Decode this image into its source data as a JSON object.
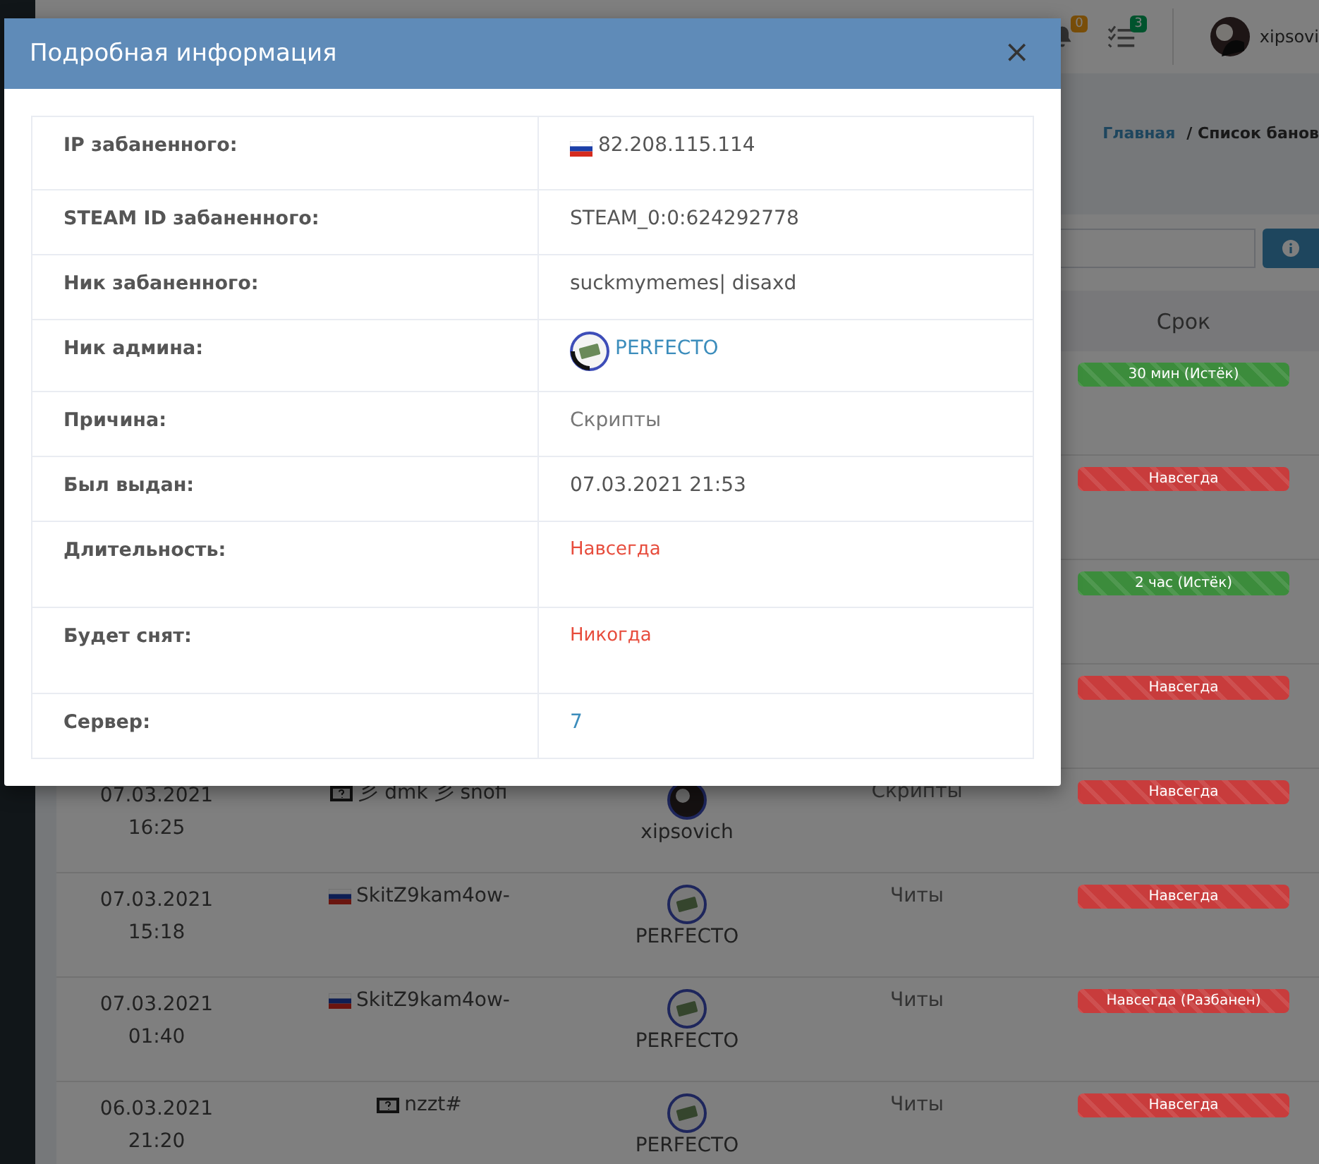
{
  "header": {
    "notifications_badge": "0",
    "tasks_badge": "3",
    "user_name": "xipsovi"
  },
  "breadcrumb": [
    {
      "label": "Главная",
      "kind": "link"
    },
    {
      "label": "/ Список банов",
      "kind": "current"
    }
  ],
  "table": {
    "term_header": "Срок",
    "rows": [
      {
        "term": {
          "text": "30 мин (Истёк)",
          "color": "#3c8c3c"
        }
      },
      {
        "term": {
          "text": "Навсегда",
          "color": "#c83c3c"
        }
      },
      {
        "term": {
          "text": "2 час (Истёк)",
          "color": "#3c8c3c"
        }
      },
      {
        "term": {
          "text": "Навсегда",
          "color": "#c83c3c"
        }
      },
      {
        "date": "07.03.2021",
        "time": "16:25",
        "player": {
          "kind": "unknown",
          "name": "彡 dmk 彡 snofi"
        },
        "admin": {
          "name": "xipsovich",
          "kind": "dark"
        },
        "reason": "Скрипты",
        "term": {
          "text": "Навсегда",
          "color": "#c83c3c"
        }
      },
      {
        "date": "07.03.2021",
        "time": "15:18",
        "player": {
          "kind": "ru",
          "name": "SkitZ9kam4ow-"
        },
        "admin": {
          "name": "PERFECTO",
          "kind": "money"
        },
        "reason": "Читы",
        "term": {
          "text": "Навсегда",
          "color": "#c83c3c"
        }
      },
      {
        "date": "07.03.2021",
        "time": "01:40",
        "player": {
          "kind": "ru",
          "name": "SkitZ9kam4ow-"
        },
        "admin": {
          "name": "PERFECTO",
          "kind": "money"
        },
        "reason": "Читы",
        "term": {
          "text": "Навсегда (Разбанен)",
          "color": "#c83c3c"
        }
      },
      {
        "date": "06.03.2021",
        "time": "21:20",
        "player": {
          "kind": "unknown",
          "name": "nzzt#"
        },
        "admin": {
          "name": "PERFECTO",
          "kind": "money"
        },
        "reason": "Читы",
        "term": {
          "text": "Навсегда",
          "color": "#c83c3c"
        }
      }
    ]
  },
  "modal": {
    "title": "Подробная информация",
    "close": "×",
    "rows": [
      {
        "label": "IP забаненного:",
        "value": "82.208.115.114",
        "kind": "flag"
      },
      {
        "label": "STEAM ID забаненного:",
        "value": "STEAM_0:0:624292778",
        "kind": "text"
      },
      {
        "label": "Ник забаненного:",
        "value": "suckmymemes| disaxd",
        "kind": "text"
      },
      {
        "label": "Ник админа:",
        "value": "PERFECTO",
        "kind": "admin"
      },
      {
        "label": "Причина:",
        "value": "Скрипты",
        "kind": "muted"
      },
      {
        "label": "Был выдан:",
        "value": "07.03.2021 21:53",
        "kind": "text"
      },
      {
        "label": "Длительность:",
        "value": "Навсегда",
        "kind": "danger"
      },
      {
        "label": "Будет снят:",
        "value": "Никогда",
        "kind": "danger"
      },
      {
        "label": "Сервер:",
        "value": "7",
        "kind": "link"
      }
    ]
  }
}
